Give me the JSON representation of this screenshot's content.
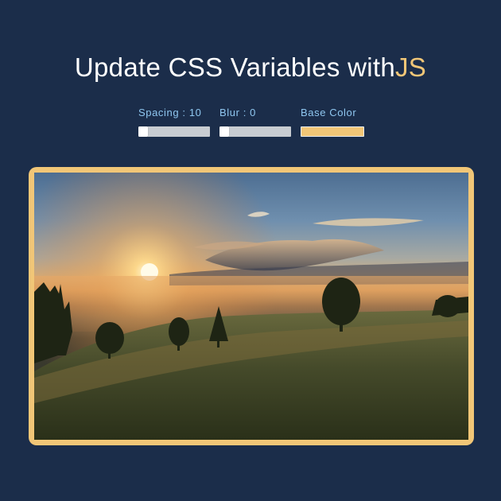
{
  "header": {
    "title_prefix": "Update CSS Variables with",
    "title_highlight": "JS"
  },
  "controls": {
    "spacing": {
      "label": "Spacing : 10",
      "value": 10,
      "min": 10,
      "max": 200
    },
    "blur": {
      "label": "Blur : 0",
      "value": 0,
      "min": 0,
      "max": 25
    },
    "base_color": {
      "label": "Base Color",
      "value": "#f1c677"
    }
  },
  "colors": {
    "background": "#1b2d4a",
    "accent": "#f1c677",
    "label": "#8fc7f0"
  }
}
